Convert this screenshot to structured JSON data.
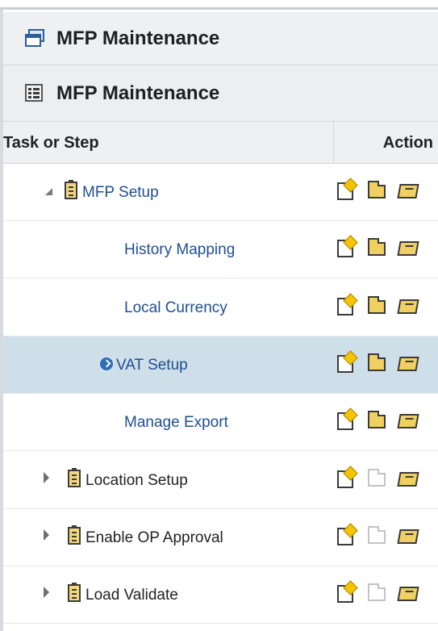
{
  "header_primary": {
    "title": "MFP Maintenance",
    "icon": "window-stack-icon"
  },
  "header_secondary": {
    "title": "MFP Maintenance",
    "icon": "list-panel-icon"
  },
  "table": {
    "columns": {
      "task": "Task or Step",
      "action": "Action"
    },
    "rows": [
      {
        "label": "MFP Setup",
        "level": 0,
        "expand": "expanded",
        "style": "link",
        "task_icon": true,
        "selected": false,
        "actions": [
          "create-icon",
          "open-icon",
          "edit-icon"
        ],
        "action_states": [
          true,
          true,
          true
        ]
      },
      {
        "label": "History Mapping",
        "level": 1,
        "expand": "none",
        "style": "link",
        "task_icon": false,
        "selected": false,
        "actions": [
          "create-icon",
          "open-icon",
          "edit-icon"
        ],
        "action_states": [
          true,
          true,
          true
        ]
      },
      {
        "label": "Local Currency",
        "level": 1,
        "expand": "none",
        "style": "link",
        "task_icon": false,
        "selected": false,
        "actions": [
          "create-icon",
          "open-icon",
          "edit-icon"
        ],
        "action_states": [
          true,
          true,
          true
        ]
      },
      {
        "label": "VAT Setup",
        "level": 1,
        "expand": "none",
        "style": "link",
        "task_icon": false,
        "selected": true,
        "current_marker": "go-arrow-icon",
        "actions": [
          "create-icon",
          "open-icon",
          "edit-icon"
        ],
        "action_states": [
          true,
          true,
          true
        ]
      },
      {
        "label": "Manage Export",
        "level": 1,
        "expand": "none",
        "style": "link",
        "task_icon": false,
        "selected": false,
        "actions": [
          "create-icon",
          "open-icon",
          "edit-icon"
        ],
        "action_states": [
          true,
          true,
          true
        ]
      },
      {
        "label": "Location Setup",
        "level": 0,
        "expand": "collapsed",
        "style": "plain",
        "task_icon": true,
        "selected": false,
        "actions": [
          "create-icon",
          "open-icon",
          "edit-icon"
        ],
        "action_states": [
          true,
          false,
          true
        ]
      },
      {
        "label": "Enable OP Approval",
        "level": 0,
        "expand": "collapsed",
        "style": "plain",
        "task_icon": true,
        "selected": false,
        "actions": [
          "create-icon",
          "open-icon",
          "edit-icon"
        ],
        "action_states": [
          true,
          false,
          true
        ]
      },
      {
        "label": "Load Validate",
        "level": 0,
        "expand": "collapsed",
        "style": "plain",
        "task_icon": true,
        "selected": false,
        "actions": [
          "create-icon",
          "open-icon",
          "edit-icon"
        ],
        "action_states": [
          true,
          false,
          true
        ]
      }
    ]
  },
  "colors": {
    "link": "#1f4f91",
    "selected_row": "#cfdfea",
    "header_bg": "#eef0f2"
  }
}
